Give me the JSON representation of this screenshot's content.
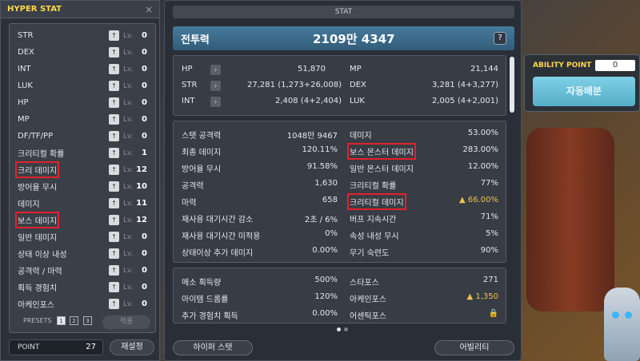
{
  "hyper": {
    "title": "HYPER STAT",
    "close": "×",
    "lv_label": "Lv.",
    "up_glyph": "↑",
    "rows": [
      {
        "name": "STR",
        "lv": "0"
      },
      {
        "name": "DEX",
        "lv": "0"
      },
      {
        "name": "INT",
        "lv": "0"
      },
      {
        "name": "LUK",
        "lv": "0"
      },
      {
        "name": "HP",
        "lv": "0"
      },
      {
        "name": "MP",
        "lv": "0"
      },
      {
        "name": "DF/TF/PP",
        "lv": "0"
      },
      {
        "name": "크리티컬 확률",
        "lv": "1"
      },
      {
        "name": "크리 데미지",
        "lv": "12"
      },
      {
        "name": "방어율 무시",
        "lv": "10"
      },
      {
        "name": "데미지",
        "lv": "11"
      },
      {
        "name": "보스 데미지",
        "lv": "12"
      },
      {
        "name": "일반 데미지",
        "lv": "0"
      },
      {
        "name": "상태 이상 내성",
        "lv": "0"
      },
      {
        "name": "공격력 / 마력",
        "lv": "0"
      },
      {
        "name": "획득 경험치",
        "lv": "0"
      },
      {
        "name": "아케인포스",
        "lv": "0"
      }
    ],
    "presets_label": "PRESETS",
    "presets": [
      "1",
      "2",
      "3"
    ],
    "apply": "적용",
    "point_label": "POINT",
    "point_value": "27",
    "reset": "재설정"
  },
  "stat": {
    "title": "STAT",
    "combat_label": "전투력",
    "combat_value": "2109만 4347",
    "help": "?",
    "plus_glyph": "+",
    "basic": {
      "hp_k": "HP",
      "hp_v": "51,870",
      "mp_k": "MP",
      "mp_v": "21,144",
      "str_k": "STR",
      "str_v": "27,281 (1,273+26,008)",
      "dex_k": "DEX",
      "dex_v": "3,281 (4+3,277)",
      "int_k": "INT",
      "int_v": "2,408 (4+2,404)",
      "luk_k": "LUK",
      "luk_v": "2,005 (4+2,001)"
    },
    "detail_left": [
      {
        "k": "스탯 공격력",
        "v": "1048만 9467"
      },
      {
        "k": "최종 데미지",
        "v": "120.11%"
      },
      {
        "k": "방어율 무시",
        "v": "91.58%"
      },
      {
        "k": "공격력",
        "v": "1,630"
      },
      {
        "k": "마력",
        "v": "658"
      },
      {
        "k": "재사용 대기시간 감소",
        "v": "2초 / 6%"
      },
      {
        "k": "재사용 대기시간 미적용",
        "v": "0%"
      },
      {
        "k": "상태이상 추가 데미지",
        "v": "0.00%"
      }
    ],
    "detail_right": [
      {
        "k": "데미지",
        "v": "53.00%"
      },
      {
        "k": "보스 몬스터 데미지",
        "v": "283.00%"
      },
      {
        "k": "일반 몬스터 데미지",
        "v": "12.00%"
      },
      {
        "k": "크리티컬 확률",
        "v": "77%"
      },
      {
        "k": "크리티컬 데미지",
        "v": "▲ 66.00%"
      },
      {
        "k": "버프 지속시간",
        "v": "71%"
      },
      {
        "k": "속성 내성 무시",
        "v": "5%"
      },
      {
        "k": "무기 숙련도",
        "v": "90%"
      }
    ],
    "misc_left": [
      {
        "k": "메소 획득량",
        "v": "500%"
      },
      {
        "k": "아이템 드롭률",
        "v": "120%"
      },
      {
        "k": "추가 경험치 획득",
        "v": "0.00%"
      }
    ],
    "misc_right": [
      {
        "k": "스타포스",
        "v": "271"
      },
      {
        "k": "아케인포스",
        "v": "▲ 1,350"
      },
      {
        "k": "어센틱포스",
        "v": "🔒"
      }
    ],
    "hyper_btn": "하이퍼 스탯",
    "ability_btn": "어빌리티"
  },
  "ability": {
    "label": "ABILITY POINT",
    "value": "0",
    "auto": "자동배분"
  }
}
